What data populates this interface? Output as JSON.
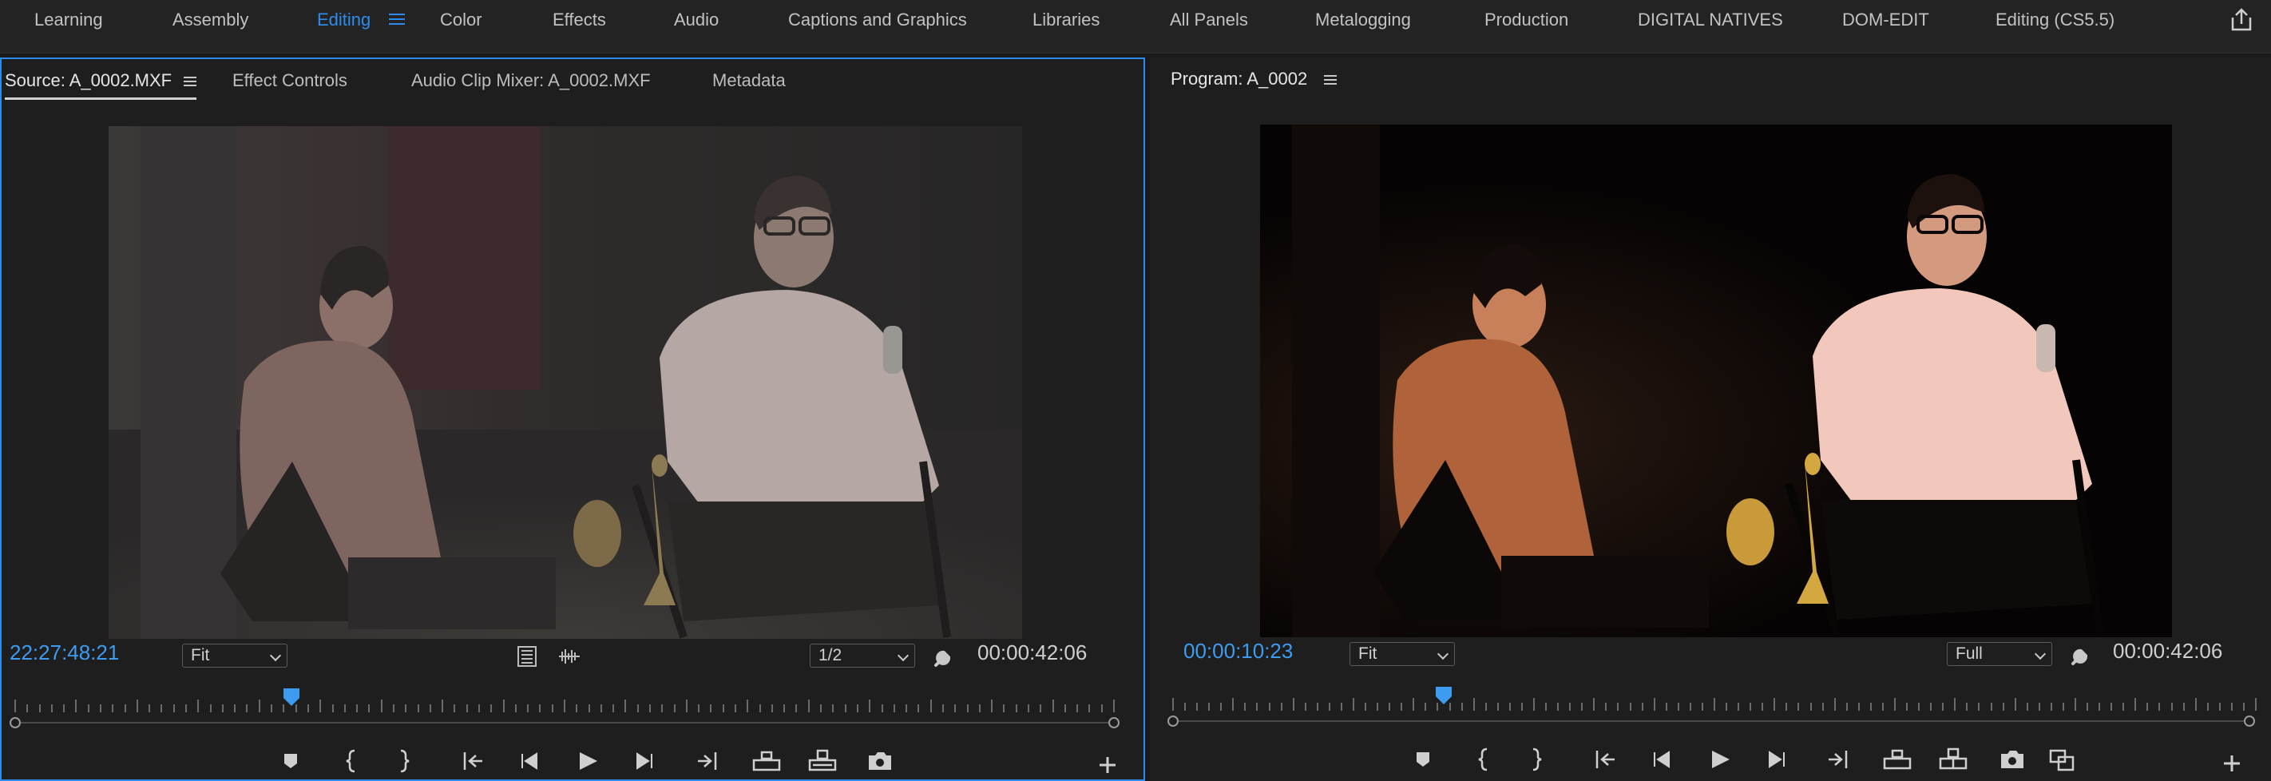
{
  "workspaces": [
    {
      "label": "Learning"
    },
    {
      "label": "Assembly"
    },
    {
      "label": "Editing",
      "active": true
    },
    {
      "label": "Color"
    },
    {
      "label": "Effects"
    },
    {
      "label": "Audio"
    },
    {
      "label": "Captions and Graphics"
    },
    {
      "label": "Libraries"
    },
    {
      "label": "All Panels"
    },
    {
      "label": "Metalogging"
    },
    {
      "label": "Production"
    },
    {
      "label": "DIGITAL NATIVES"
    },
    {
      "label": "DOM-EDIT"
    },
    {
      "label": "Editing (CS5.5)"
    }
  ],
  "source": {
    "tabs": {
      "source": "Source: A_0002.MXF",
      "effect_controls": "Effect Controls",
      "audio_mixer": "Audio Clip Mixer: A_0002.MXF",
      "metadata": "Metadata"
    },
    "timecode": "22:27:48:21",
    "zoom": "Fit",
    "resolution": "1/2",
    "duration": "00:00:42:06",
    "playhead_fraction": 0.25
  },
  "program": {
    "title": "Program: A_0002",
    "timecode": "00:00:10:23",
    "zoom": "Fit",
    "resolution": "Full",
    "duration": "00:00:42:06",
    "playhead_fraction": 0.25
  },
  "colors": {
    "accent": "#2d8ceb",
    "timecode_blue": "#3d9cf0"
  },
  "icons": {
    "export": "export-icon",
    "settings": "wrench-icon",
    "add": "plus-icon"
  }
}
